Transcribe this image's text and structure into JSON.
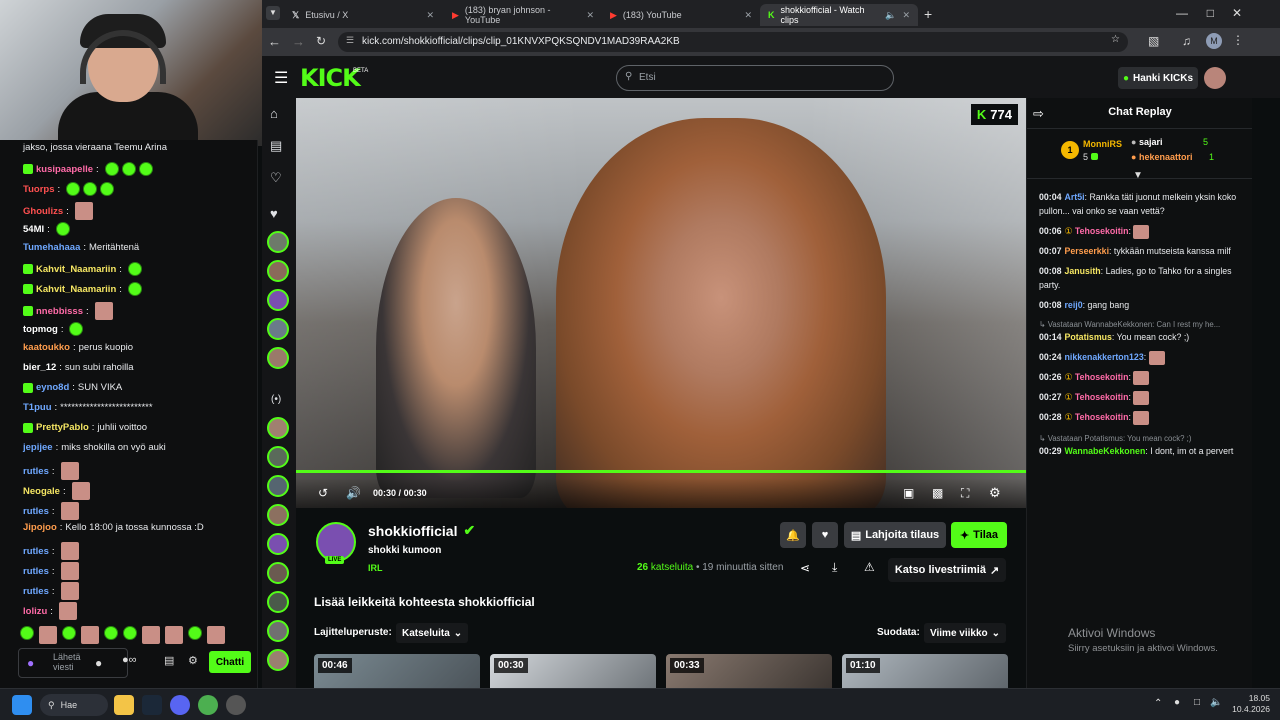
{
  "browser": {
    "tabs": [
      {
        "title": "Etusivu / X",
        "icon": "x-logo-icon"
      },
      {
        "title": "(183) bryan johnson - YouTube",
        "icon": "youtube-icon"
      },
      {
        "title": "(183) YouTube",
        "icon": "youtube-icon"
      },
      {
        "title": "shokkiofficial - Watch clips",
        "icon": "kick-icon"
      }
    ],
    "url": "kick.com/shokkiofficial/clips/clip_01KNVXPQKSQNDV1MAD39RAA2KB"
  },
  "kick": {
    "logo": "KICK",
    "logo_beta": "BETA",
    "search_placeholder": "Etsi",
    "hanki_label": "Hanki KICKs"
  },
  "video": {
    "viewers": "774",
    "time_current": "00:30",
    "time_separator": "/",
    "time_total": "00:30",
    "progress": 1.0
  },
  "channel": {
    "name": "shokkiofficial",
    "live_label": "LIVE",
    "clip_title": "shokki kumoon",
    "category": "IRL",
    "views_count": "26",
    "views_label": "katseluita",
    "time_ago": "• 19 minuuttia sitten",
    "gift_label": "Lahjoita tilaus",
    "follow_label": "Tilaa",
    "watch_stream_label": "Katso livestriimiä",
    "more_clips_heading": "Lisää leikkeitä kohteesta shokkiofficial",
    "sort_label": "Lajitteluperuste:",
    "sort_value": "Katseluita",
    "filter_label": "Suodata:",
    "filter_value": "Viime viikko",
    "thumbs": [
      "00:46",
      "00:30",
      "00:33",
      "01:10"
    ]
  },
  "chat_replay": {
    "title": "Chat Replay",
    "leaderboard": [
      {
        "rank": "1",
        "name": "MonniRS",
        "value": "5"
      },
      {
        "name": "sajari",
        "value": "5"
      },
      {
        "name": "hekenaattori",
        "value": "1"
      }
    ],
    "messages": [
      {
        "time": "00:04",
        "user": "Art5i",
        "color": "#6fa8ff",
        "text": "Rankka täti juonut melkein yksin koko pullon... vai onko se vaan vettä?"
      },
      {
        "time": "00:06",
        "user": "Tehosekoitin",
        "color": "#ff6ba8",
        "text": ""
      },
      {
        "time": "00:07",
        "user": "Perseerkki",
        "color": "#ff9d4d",
        "text": "tykkään mutseista kanssa milf"
      },
      {
        "time": "00:08",
        "user": "Janusith",
        "color": "#f5e663",
        "text": "Ladies, go to Tahko for a singles party."
      },
      {
        "time": "00:08",
        "user": "reij0",
        "color": "#6fa8ff",
        "text": "gang bang"
      },
      {
        "reply": "Vastataan WannabeKekkonen: Can I rest my he..."
      },
      {
        "time": "00:14",
        "user": "Potatismus",
        "color": "#f5e663",
        "text": "You mean cock? ;)"
      },
      {
        "time": "00:24",
        "user": "nikkenakkerton123",
        "color": "#6fa8ff",
        "text": ""
      },
      {
        "time": "00:26",
        "user": "Tehosekoitin",
        "color": "#ff6ba8",
        "text": ""
      },
      {
        "time": "00:27",
        "user": "Tehosekoitin",
        "color": "#ff6ba8",
        "text": ""
      },
      {
        "time": "00:28",
        "user": "Tehosekoitin",
        "color": "#ff6ba8",
        "text": ""
      },
      {
        "reply": "Vastataan Potatismus: You mean cock? ;)"
      },
      {
        "time": "00:29",
        "user": "WannabeKekkonen",
        "color": "#53fc18",
        "text": "I dont, im ot a pervert"
      }
    ]
  },
  "left_chat": {
    "top_text": "jakso, jossa vieraana Teemu Arina",
    "lines": [
      {
        "user": "kusipaapelle",
        "color": "#ff6ba8",
        "text": ""
      },
      {
        "user": "Tuorps",
        "color": "#ff5050",
        "text": ""
      },
      {
        "user": "Ghoulizs",
        "color": "#ff5050",
        "text": ""
      },
      {
        "user": "54MI",
        "color": "#ffffff",
        "text": ""
      },
      {
        "user": "Tumehahaaa",
        "color": "#6fa8ff",
        "text": "Meritähtenä"
      },
      {
        "user": "Kahvit_Naamariin",
        "color": "#f5e663",
        "text": ""
      },
      {
        "user": "Kahvit_Naamariin",
        "color": "#f5e663",
        "text": ""
      },
      {
        "user": "nnebbisss",
        "color": "#ff6ba8",
        "text": ""
      },
      {
        "user": "topmog",
        "color": "#ffffff",
        "text": ""
      },
      {
        "user": "kaatoukko",
        "color": "#ff9d4d",
        "text": "perus kuopio"
      },
      {
        "user": "bier_12",
        "color": "#ffffff",
        "text": "sun subi rahoilla"
      },
      {
        "user": "eyno8d",
        "color": "#6fa8ff",
        "text": "SUN VIKA"
      },
      {
        "user": "T1puu",
        "color": "#6fa8ff",
        "text": "*************************"
      },
      {
        "user": "PrettyPablo",
        "color": "#f5e663",
        "text": "juhlii voittoo"
      },
      {
        "user": "jepijee",
        "color": "#6fa8ff",
        "text": "miks shokilla on vyö auki"
      },
      {
        "user": "rutles",
        "color": "#6fa8ff",
        "text": ""
      },
      {
        "user": "Neogale",
        "color": "#f5e663",
        "text": ""
      },
      {
        "user": "rutles",
        "color": "#6fa8ff",
        "text": ""
      },
      {
        "user": "Jipojoo",
        "color": "#ff9d4d",
        "text": "Kello 18:00 ja tossa kunnossa :D"
      },
      {
        "user": "rutles",
        "color": "#6fa8ff",
        "text": ""
      },
      {
        "user": "rutles",
        "color": "#6fa8ff",
        "text": ""
      },
      {
        "user": "rutles",
        "color": "#6fa8ff",
        "text": ""
      },
      {
        "user": "lolizu",
        "color": "#ff6ba8",
        "text": ""
      }
    ],
    "input_placeholder": "Lähetä viesti",
    "chat_button": "Chatti"
  },
  "windows": {
    "watermark_title": "Aktivoi Windows",
    "watermark_sub": "Siirry asetuksiin ja aktivoi Windows.",
    "search_label": "Hae",
    "time": "18.05",
    "date": "10.4.2026"
  },
  "colors": {
    "kick_green": "#53fc18",
    "bg": "#0b0e0f"
  }
}
